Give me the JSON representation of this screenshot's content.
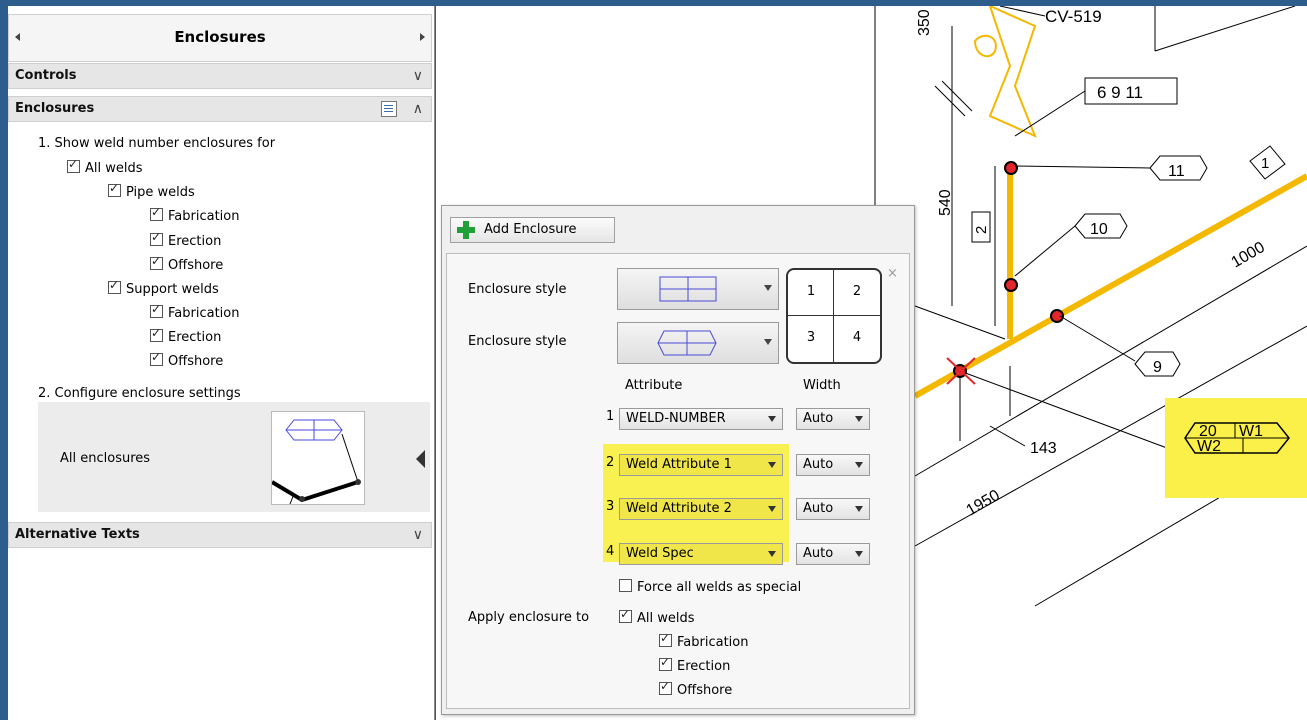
{
  "panel": {
    "title": "Enclosures",
    "sections": {
      "controls": "Controls",
      "enclosures": "Enclosures",
      "alternative_texts": "Alternative Texts"
    },
    "step1": "1. Show weld number enclosures for",
    "checks": {
      "all_welds": "All welds",
      "pipe_welds": "Pipe welds",
      "pipe_fabrication": "Fabrication",
      "pipe_erection": "Erection",
      "pipe_offshore": "Offshore",
      "support_welds": "Support welds",
      "support_fabrication": "Fabrication",
      "support_erection": "Erection",
      "support_offshore": "Offshore"
    },
    "step2": "2. Configure enclosure settings",
    "all_enclosures": "All enclosures"
  },
  "popup": {
    "add_button": "Add Enclosure",
    "style_label_1": "Enclosure style",
    "style_label_2": "Enclosure style",
    "grid": [
      "1",
      "2",
      "3",
      "4"
    ],
    "close": "×",
    "attribute_header": "Attribute",
    "width_header": "Width",
    "rows": [
      {
        "num": "1",
        "attribute": "WELD-NUMBER",
        "width": "Auto"
      },
      {
        "num": "2",
        "attribute": "Weld Attribute 1",
        "width": "Auto"
      },
      {
        "num": "3",
        "attribute": "Weld Attribute 2",
        "width": "Auto"
      },
      {
        "num": "4",
        "attribute": "Weld Spec",
        "width": "Auto"
      }
    ],
    "force_special": "Force all welds as special",
    "apply_label": "Apply enclosure to",
    "apply": {
      "all_welds": "All welds",
      "fabrication": "Fabrication",
      "erection": "Erection",
      "offshore": "Offshore"
    }
  },
  "drawing": {
    "labels": {
      "cv": "CV-519",
      "dim_350": "350",
      "dim_540": "540",
      "tag_2": "2",
      "box_6911": "6 9 11",
      "weld_11": "11",
      "weld_1": "1",
      "weld_10": "10",
      "dim_1000": "1000",
      "weld_9": "9",
      "dim_143": "143",
      "dim_1950": "1950",
      "enc_20": "20",
      "enc_w1": "W1",
      "enc_w2": "W2"
    }
  },
  "colors": {
    "pipe": "#f5b800",
    "highlight": "#fbef4a",
    "weld_dot": "#e3262b",
    "plus": "#21a03a",
    "window_frame": "#2d5d8c"
  }
}
